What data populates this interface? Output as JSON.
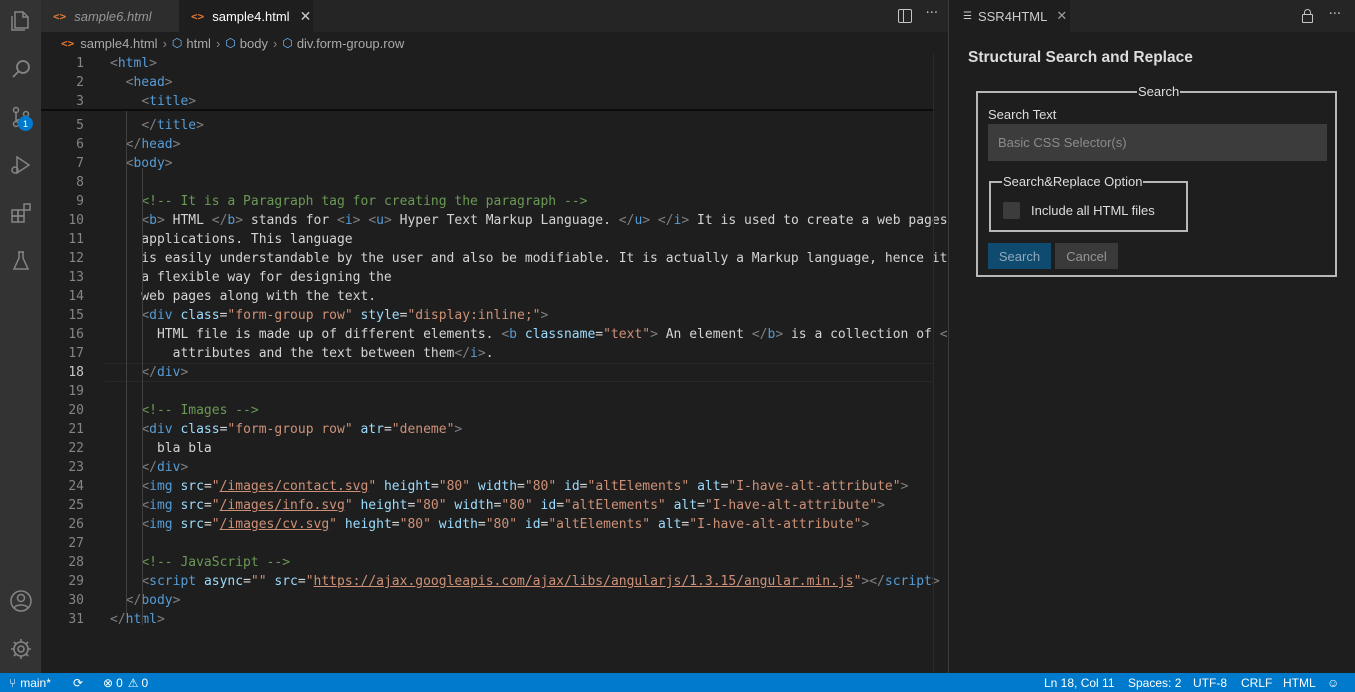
{
  "activity_bar": {
    "icons": [
      "explorer-icon",
      "search-icon",
      "source-control-icon",
      "run-debug-icon",
      "extensions-icon",
      "testing-icon",
      "accounts-icon",
      "manage-gear-icon"
    ],
    "source_control_badge": "1"
  },
  "tabs": [
    {
      "label": "sample6.html",
      "active": false,
      "italic": true
    },
    {
      "label": "sample4.html",
      "active": true,
      "close": "✕"
    }
  ],
  "breadcrumb": {
    "items": [
      "sample4.html",
      "html",
      "body",
      "div.form-group.row"
    ]
  },
  "editor": {
    "active_line": 18,
    "lines": [
      {
        "n": "1",
        "html": "<span class=\"t-br\">&lt;</span><span class=\"t-tag\">html</span><span class=\"t-br\">&gt;</span>"
      },
      {
        "n": "2",
        "html": "  <span class=\"t-br\">&lt;</span><span class=\"t-tag\">head</span><span class=\"t-br\">&gt;</span>"
      },
      {
        "n": "3",
        "html": "    <span class=\"t-br\">&lt;</span><span class=\"t-tag\">title</span><span class=\"t-br\">&gt;</span>"
      },
      {
        "n": "5",
        "html": "    <span class=\"t-br\">&lt;/</span><span class=\"t-tag\">title</span><span class=\"t-br\">&gt;</span>"
      },
      {
        "n": "6",
        "html": "  <span class=\"t-br\">&lt;/</span><span class=\"t-tag\">head</span><span class=\"t-br\">&gt;</span>"
      },
      {
        "n": "7",
        "html": "  <span class=\"t-br\">&lt;</span><span class=\"t-tag\">body</span><span class=\"t-br\">&gt;</span>"
      },
      {
        "n": "8",
        "html": ""
      },
      {
        "n": "9",
        "html": "    <span class=\"t-com\">&lt;!-- It is a Paragraph tag for creating the paragraph --&gt;</span>"
      },
      {
        "n": "10",
        "html": "    <span class=\"t-br\">&lt;</span><span class=\"t-tag\">b</span><span class=\"t-br\">&gt;</span> HTML <span class=\"t-br\">&lt;/</span><span class=\"t-tag\">b</span><span class=\"t-br\">&gt;</span> stands for <span class=\"t-br\">&lt;</span><span class=\"t-tag\">i</span><span class=\"t-br\">&gt;</span> <span class=\"t-br\">&lt;</span><span class=\"t-tag\">u</span><span class=\"t-br\">&gt;</span> Hyper Text Markup Language. <span class=\"t-br\">&lt;/</span><span class=\"t-tag\">u</span><span class=\"t-br\">&gt;</span> <span class=\"t-br\">&lt;/</span><span class=\"t-tag\">i</span><span class=\"t-br\">&gt;</span> It is used to create a web pages and"
      },
      {
        "n": "11",
        "html": "    applications. This language"
      },
      {
        "n": "12",
        "html": "    is easily understandable by the user and also be modifiable. It is actually a Markup language, hence it provides"
      },
      {
        "n": "13",
        "html": "    a flexible way for designing the"
      },
      {
        "n": "14",
        "html": "    web pages along with the text."
      },
      {
        "n": "15",
        "html": "    <span class=\"t-br\">&lt;</span><span class=\"t-tag\">div</span> <span class=\"t-attr\">class</span>=<span class=\"t-str\">\"form-group row\"</span> <span class=\"t-attr\">style</span>=<span class=\"t-str\">\"display:inline;\"</span><span class=\"t-br\">&gt;</span>"
      },
      {
        "n": "16",
        "html": "      HTML file is made up of different elements. <span class=\"t-br\">&lt;</span><span class=\"t-tag\">b</span> <span class=\"t-attr\">classname</span>=<span class=\"t-str\">\"text\"</span><span class=\"t-br\">&gt;</span> An element <span class=\"t-br\">&lt;/</span><span class=\"t-tag\">b</span><span class=\"t-br\">&gt;</span> is a collection of <span class=\"t-br\">&lt;</span><span class=\"t-tag\">i</span><span class=\"t-br\">&gt;</span>"
      },
      {
        "n": "17",
        "html": "        attributes and the text between them<span class=\"t-br\">&lt;/</span><span class=\"t-tag\">i</span><span class=\"t-br\">&gt;</span>."
      },
      {
        "n": "18",
        "html": "    <span class=\"t-br\">&lt;/</span><span class=\"t-tag\">div</span><span class=\"t-br\">&gt;</span>"
      },
      {
        "n": "19",
        "html": ""
      },
      {
        "n": "20",
        "html": "    <span class=\"t-com\">&lt;!-- Images --&gt;</span>"
      },
      {
        "n": "21",
        "html": "    <span class=\"t-br\">&lt;</span><span class=\"t-tag\">div</span> <span class=\"t-attr\">class</span>=<span class=\"t-str\">\"form-group row\"</span> <span class=\"t-attr\">atr</span>=<span class=\"t-str\">\"deneme\"</span><span class=\"t-br\">&gt;</span>"
      },
      {
        "n": "22",
        "html": "      bla bla"
      },
      {
        "n": "23",
        "html": "    <span class=\"t-br\">&lt;/</span><span class=\"t-tag\">div</span><span class=\"t-br\">&gt;</span>"
      },
      {
        "n": "24",
        "html": "    <span class=\"t-br\">&lt;</span><span class=\"t-tag\">img</span> <span class=\"t-attr\">src</span>=<span class=\"t-str\">\"</span><span class=\"t-link\">/images/contact.svg</span><span class=\"t-str\">\"</span> <span class=\"t-attr\">height</span>=<span class=\"t-str\">\"80\"</span> <span class=\"t-attr\">width</span>=<span class=\"t-str\">\"80\"</span> <span class=\"t-attr\">id</span>=<span class=\"t-str\">\"altElements\"</span> <span class=\"t-attr\">alt</span>=<span class=\"t-str\">\"I-have-alt-attribute\"</span><span class=\"t-br\">&gt;</span>"
      },
      {
        "n": "25",
        "html": "    <span class=\"t-br\">&lt;</span><span class=\"t-tag\">img</span> <span class=\"t-attr\">src</span>=<span class=\"t-str\">\"</span><span class=\"t-link\">/images/info.svg</span><span class=\"t-str\">\"</span> <span class=\"t-attr\">height</span>=<span class=\"t-str\">\"80\"</span> <span class=\"t-attr\">width</span>=<span class=\"t-str\">\"80\"</span> <span class=\"t-attr\">id</span>=<span class=\"t-str\">\"altElements\"</span> <span class=\"t-attr\">alt</span>=<span class=\"t-str\">\"I-have-alt-attribute\"</span><span class=\"t-br\">&gt;</span>"
      },
      {
        "n": "26",
        "html": "    <span class=\"t-br\">&lt;</span><span class=\"t-tag\">img</span> <span class=\"t-attr\">src</span>=<span class=\"t-str\">\"</span><span class=\"t-link\">/images/cv.svg</span><span class=\"t-str\">\"</span> <span class=\"t-attr\">height</span>=<span class=\"t-str\">\"80\"</span> <span class=\"t-attr\">width</span>=<span class=\"t-str\">\"80\"</span> <span class=\"t-attr\">id</span>=<span class=\"t-str\">\"altElements\"</span> <span class=\"t-attr\">alt</span>=<span class=\"t-str\">\"I-have-alt-attribute\"</span><span class=\"t-br\">&gt;</span>"
      },
      {
        "n": "27",
        "html": ""
      },
      {
        "n": "28",
        "html": "    <span class=\"t-com\">&lt;!-- JavaScript --&gt;</span>"
      },
      {
        "n": "29",
        "html": "    <span class=\"t-br\">&lt;</span><span class=\"t-tag\">script</span> <span class=\"t-attr\">async</span>=<span class=\"t-str\">\"\"</span> <span class=\"t-attr\">src</span>=<span class=\"t-str\">\"</span><span class=\"t-link\">https://ajax.googleapis.com/ajax/libs/angularjs/1.3.15/angular.min.js</span><span class=\"t-str\">\"</span><span class=\"t-br\">&gt;&lt;/</span><span class=\"t-tag\">script</span><span class=\"t-br\">&gt;</span>"
      },
      {
        "n": "30",
        "html": "  <span class=\"t-br\">&lt;/</span><span class=\"t-tag\">body</span><span class=\"t-br\">&gt;</span>"
      },
      {
        "n": "31",
        "html": "<span class=\"t-br\">&lt;/</span><span class=\"t-tag\">html</span><span class=\"t-br\">&gt;</span>"
      }
    ]
  },
  "panel": {
    "tab_label": "SSR4HTML",
    "tab_close": "✕",
    "more_label": "···",
    "title": "Structural Search and Replace",
    "search_legend": "Search",
    "search_text_label": "Search Text",
    "search_placeholder": "Basic CSS Selector(s)",
    "options_legend": "Search&Replace Option",
    "include_all_label": "Include all HTML files",
    "search_button": "Search",
    "cancel_button": "Cancel"
  },
  "editor_actions": {
    "more_label": "···"
  },
  "status_bar": {
    "branch": "main*",
    "errors": "0",
    "warnings": "0",
    "position": "Ln 18, Col 11",
    "spaces": "Spaces: 2",
    "encoding": "UTF-8",
    "eol": "CRLF",
    "language": "HTML"
  },
  "colors": {
    "status_bar": "#007acc",
    "activity_bar": "#333333",
    "editor_bg": "#1e1e1e"
  }
}
